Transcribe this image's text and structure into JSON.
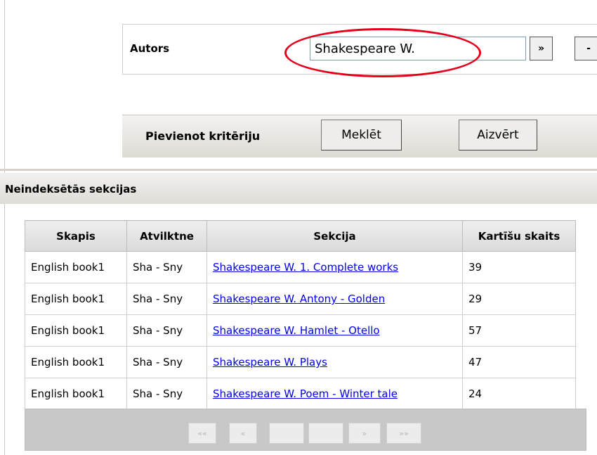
{
  "criteria": {
    "author_label": "Autors",
    "author_value": "Shakespeare W.",
    "go_button": "»",
    "remove_button": "-"
  },
  "actions": {
    "add_criterion": "Pievienot kritēriju",
    "search": "Meklēt",
    "close": "Aizvērt"
  },
  "section": {
    "title": "Neindeksētās sekcijas"
  },
  "table": {
    "headers": [
      "Skapis",
      "Atvilktne",
      "Sekcija",
      "Kartīšu skaits"
    ],
    "rows": [
      {
        "skapis": "English book1",
        "atvilktne": "Sha - Sny",
        "sekcija": "Shakespeare W. 1. Complete works",
        "count": "39"
      },
      {
        "skapis": "English book1",
        "atvilktne": "Sha - Sny",
        "sekcija": "Shakespeare W. Antony - Golden",
        "count": "29"
      },
      {
        "skapis": "English book1",
        "atvilktne": "Sha - Sny",
        "sekcija": "Shakespeare W. Hamlet - Otello",
        "count": "57"
      },
      {
        "skapis": "English book1",
        "atvilktne": "Sha - Sny",
        "sekcija": "Shakespeare W. Plays",
        "count": "47"
      },
      {
        "skapis": "English book1",
        "atvilktne": "Sha - Sny",
        "sekcija": "Shakespeare W. Poem - Winter tale",
        "count": "24"
      }
    ]
  },
  "pager": {
    "first": "««",
    "prev": "«",
    "next": "»",
    "last": "»»"
  },
  "colors": {
    "highlight": "#e4001b",
    "link": "#0000ee"
  }
}
